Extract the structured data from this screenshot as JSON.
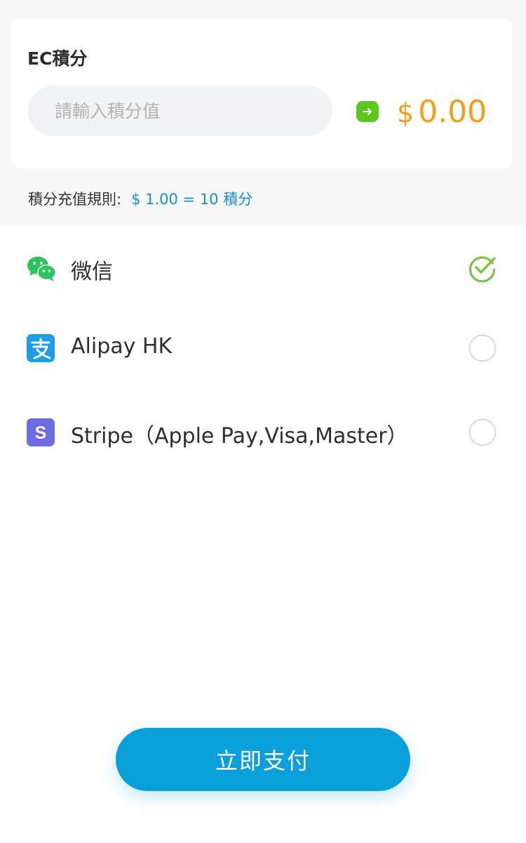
{
  "points_card": {
    "title": "EC積分",
    "input_placeholder": "請輸入積分值",
    "input_value": "",
    "currency_symbol": "$",
    "amount": "0.00"
  },
  "rule": {
    "label": "積分充值規則:",
    "value": "$ 1.00 = 10 積分"
  },
  "payment_methods": [
    {
      "icon": "wechat-icon",
      "label": "微信",
      "selected": true
    },
    {
      "icon": "alipay-icon",
      "label": "Alipay HK",
      "selected": false
    },
    {
      "icon": "stripe-icon",
      "label": "Stripe（Apple Pay,Visa,Master）",
      "selected": false
    }
  ],
  "pay_button_label": "立即支付",
  "colors": {
    "accent_blue": "#089fdb",
    "amount_orange": "#f39d1c",
    "check_green": "#7cc242",
    "wechat_green": "#2dc35e",
    "alipay_blue": "#1e9de6",
    "stripe_purple": "#6e6bde"
  }
}
